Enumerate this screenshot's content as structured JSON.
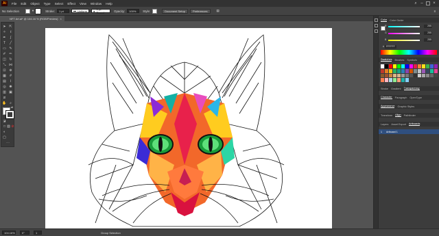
{
  "app": {
    "logo_text": "Ai"
  },
  "menu": [
    "File",
    "Edit",
    "Object",
    "Type",
    "Select",
    "Effect",
    "View",
    "Window",
    "Help"
  ],
  "control_bar": {
    "selection_label": "No Selection",
    "stroke_label": "Stroke:",
    "stroke_weight": "1 pt",
    "variable_width_label": "Uniform",
    "brush_label": "5 pt. Round",
    "opacity_label": "Opacity:",
    "opacity_value": "100%",
    "style_label": "Style:",
    "document_setup_label": "Document Setup",
    "preferences_label": "Preferences"
  },
  "document_tab": {
    "title": "NFT Art.ai* @ 104.16 % (RGB/Preview)",
    "close": "×"
  },
  "right_panels": {
    "color": {
      "tabs": [
        "Color",
        "Color Guide"
      ],
      "channels": [
        {
          "label": "R",
          "value": "255"
        },
        {
          "label": "G",
          "value": "255"
        },
        {
          "label": "B",
          "value": "255"
        }
      ],
      "hex_prefix": "#",
      "hex": "FFFFFF"
    },
    "swatches": {
      "tabs": [
        "Swatches",
        "Brushes",
        "Symbols"
      ]
    },
    "stroke_group": {
      "tabs": [
        "Stroke",
        "Gradient",
        "Transparency"
      ]
    },
    "character_group": {
      "tabs": [
        "Character",
        "Paragraph",
        "OpenType"
      ]
    },
    "appearance_group": {
      "tabs": [
        "Appearance",
        "Graphic Styles"
      ]
    },
    "transform_group": {
      "tabs": [
        "Transform",
        "Align",
        "Pathfinder"
      ]
    },
    "layers_group": {
      "tabs": [
        "Layers",
        "Asset Export",
        "Artboards"
      ]
    },
    "artboards": [
      {
        "index": "1",
        "name": "Artboard 1"
      }
    ]
  },
  "status": {
    "zoom": "104.16%",
    "angle": "0°",
    "artboard": "1",
    "tool": "Group Selection"
  },
  "colors": {
    "accent": "#2f7ae5",
    "canvas": "#535353",
    "artboard": "#ffffff"
  }
}
